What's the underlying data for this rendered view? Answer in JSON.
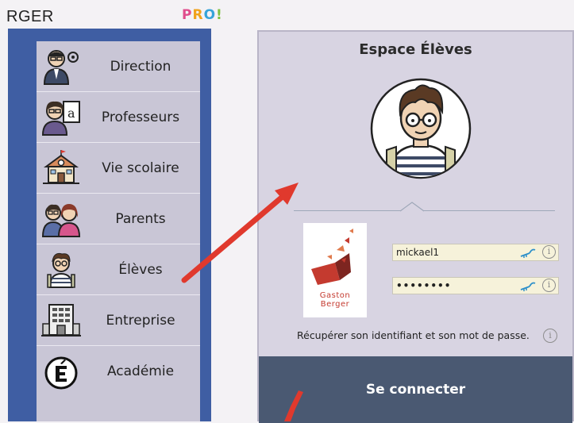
{
  "header": {
    "title": "RGER",
    "pro_badge": [
      "P",
      "R",
      "O",
      "!"
    ]
  },
  "menu": {
    "items": [
      {
        "label": "Direction",
        "icon": "director-icon"
      },
      {
        "label": "Professeurs",
        "icon": "teacher-icon"
      },
      {
        "label": "Vie scolaire",
        "icon": "school-building-icon"
      },
      {
        "label": "Parents",
        "icon": "parents-icon"
      },
      {
        "label": "Élèves",
        "icon": "student-icon"
      },
      {
        "label": "Entreprise",
        "icon": "company-icon"
      },
      {
        "label": "Académie",
        "icon": "academie-logo-icon"
      }
    ]
  },
  "login": {
    "title": "Espace Élèves",
    "logo_text": [
      "Gaston",
      "Berger"
    ],
    "username": "mickael1",
    "password": "••••••••",
    "recover_text": "Récupérer son identifiant et son mot de passe.",
    "connect_label": "Se connecter"
  },
  "colors": {
    "panel_blue": "#3f5ea3",
    "button_slate": "#4a5972",
    "arrow_red": "#e0392d"
  }
}
